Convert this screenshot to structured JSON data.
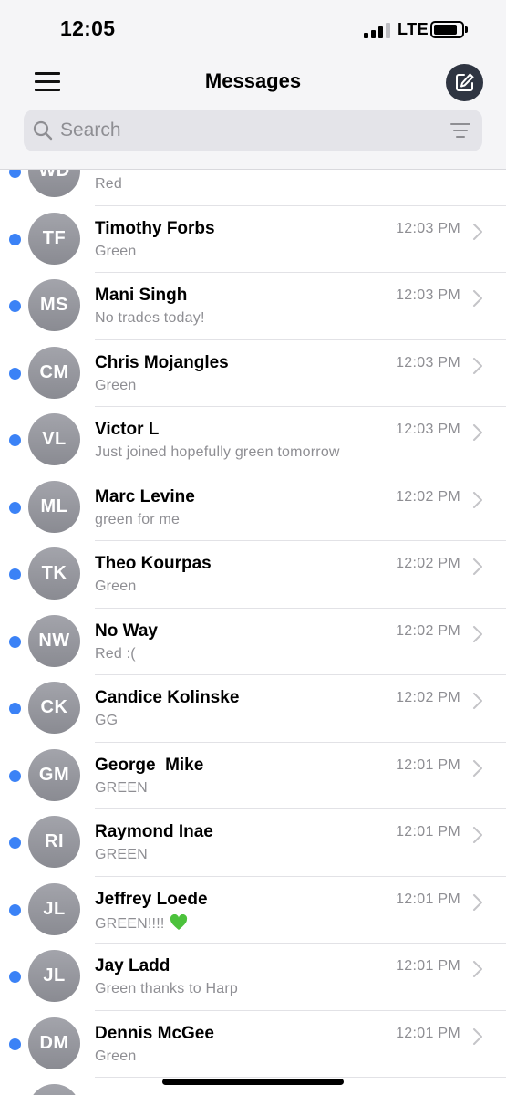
{
  "status": {
    "time": "12:05",
    "network": "LTE"
  },
  "nav": {
    "title": "Messages",
    "menu_icon": "hamburger-menu-icon",
    "compose_icon": "compose-icon"
  },
  "search": {
    "placeholder": "Search",
    "value": "",
    "filter_icon": "filter-icon"
  },
  "colors": {
    "unread_dot": "#3b82f6",
    "avatar": "#8f9097",
    "compose_bg": "#2f3542"
  },
  "conversations": [
    {
      "initials": "WD",
      "name": "",
      "preview": "Red",
      "time": "",
      "unread": true
    },
    {
      "initials": "TF",
      "name": "Timothy Forbs",
      "preview": "Green",
      "time": "12:03 PM",
      "unread": true
    },
    {
      "initials": "MS",
      "name": "Mani Singh",
      "preview": "No trades today!",
      "time": "12:03 PM",
      "unread": true
    },
    {
      "initials": "CM",
      "name": "Chris Mojangles",
      "preview": "Green",
      "time": "12:03 PM",
      "unread": true
    },
    {
      "initials": "VL",
      "name": "Victor L",
      "preview": "Just joined hopefully green tomorrow",
      "time": "12:03 PM",
      "unread": true
    },
    {
      "initials": "ML",
      "name": "Marc Levine",
      "preview": "green for me",
      "time": "12:02 PM",
      "unread": true
    },
    {
      "initials": "TK",
      "name": "Theo Kourpas",
      "preview": "Green",
      "time": "12:02 PM",
      "unread": true
    },
    {
      "initials": "NW",
      "name": "No Way",
      "preview": "Red :(",
      "time": "12:02 PM",
      "unread": true
    },
    {
      "initials": "CK",
      "name": "Candice Kolinske",
      "preview": "GG",
      "time": "12:02 PM",
      "unread": true
    },
    {
      "initials": "GM",
      "name": "George  Mike",
      "preview": "GREEN",
      "time": "12:01 PM",
      "unread": true
    },
    {
      "initials": "RI",
      "name": "Raymond Inae",
      "preview": "GREEN",
      "time": "12:01 PM",
      "unread": true
    },
    {
      "initials": "JL",
      "name": "Jeffrey Loede",
      "preview": "GREEN!!!!",
      "preview_emoji": "green-heart",
      "time": "12:01 PM",
      "unread": true
    },
    {
      "initials": "JL",
      "name": "Jay Ladd",
      "preview": "Green thanks to Harp",
      "time": "12:01 PM",
      "unread": true
    },
    {
      "initials": "DM",
      "name": "Dennis McGee",
      "preview": "Green",
      "time": "12:01 PM",
      "unread": true
    },
    {
      "initials": "",
      "name": "",
      "preview": "",
      "time": "",
      "unread": true
    }
  ]
}
